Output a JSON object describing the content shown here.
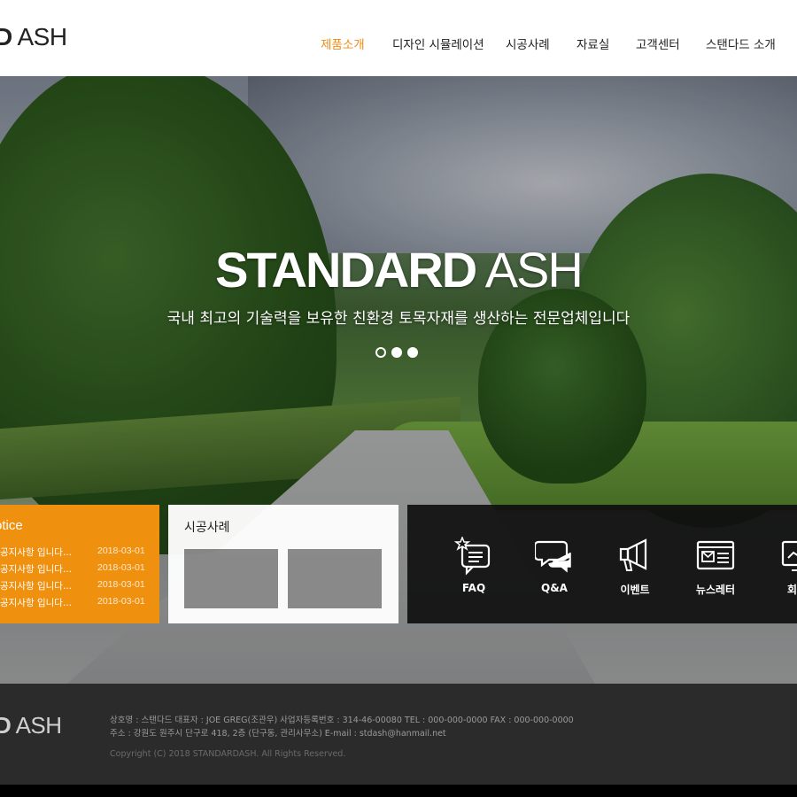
{
  "header": {
    "logo_bold": "D",
    "logo_light": "ASH",
    "nav": [
      {
        "label": "제품소개",
        "active": true
      },
      {
        "label": "디자인 시뮬레이션",
        "active": false
      },
      {
        "label": "시공사례",
        "active": false
      },
      {
        "label": "자료실",
        "active": false
      },
      {
        "label": "고객센터",
        "active": false
      },
      {
        "label": "스탠다드 소개",
        "active": false
      }
    ]
  },
  "hero": {
    "title_bold": "STANDARD",
    "title_light": "ASH",
    "subtitle": "국내 최고의 기술력을 보유한 친환경 토목자재를 생산하는 전문업체입니다",
    "slide_count": 3,
    "active_slide": 1
  },
  "notice": {
    "title": "otice",
    "items": [
      {
        "text": "공지사항 입니다...",
        "date": "2018-03-01"
      },
      {
        "text": "공지사항 입니다...",
        "date": "2018-03-01"
      },
      {
        "text": "공지사항 입니다...",
        "date": "2018-03-01"
      },
      {
        "text": "공지사항 입니다...",
        "date": "2018-03-01"
      }
    ]
  },
  "cases": {
    "title": "시공사례"
  },
  "quick_links": [
    {
      "label": "FAQ",
      "icon": "faq-icon"
    },
    {
      "label": "Q&A",
      "icon": "chat-bubbles-icon"
    },
    {
      "label": "이벤트",
      "icon": "megaphone-icon"
    },
    {
      "label": "뉴스레터",
      "icon": "newsletter-icon"
    },
    {
      "label": "회사",
      "icon": "company-icon"
    }
  ],
  "footer": {
    "logo_bold": "D",
    "logo_light": "ASH",
    "info_line1": "상호명 : 스탠다드    대표자 : JOE GREG(조관우)    사업자등록번호 : 314-46-00080    TEL : 000-000-0000    FAX : 000-000-0000",
    "info_line2": "주소 : 강원도 원주시 단구로 418, 2층 (단구동, 관리사무소)    E-mail : stdash@hanmail.net",
    "copyright": "Copyright (C) 2018 STANDARDASH. All Rights Reserved."
  },
  "colors": {
    "accent": "#f08c14",
    "notice_bg": "#f0900f",
    "footer_bg": "#2b2b2b"
  }
}
